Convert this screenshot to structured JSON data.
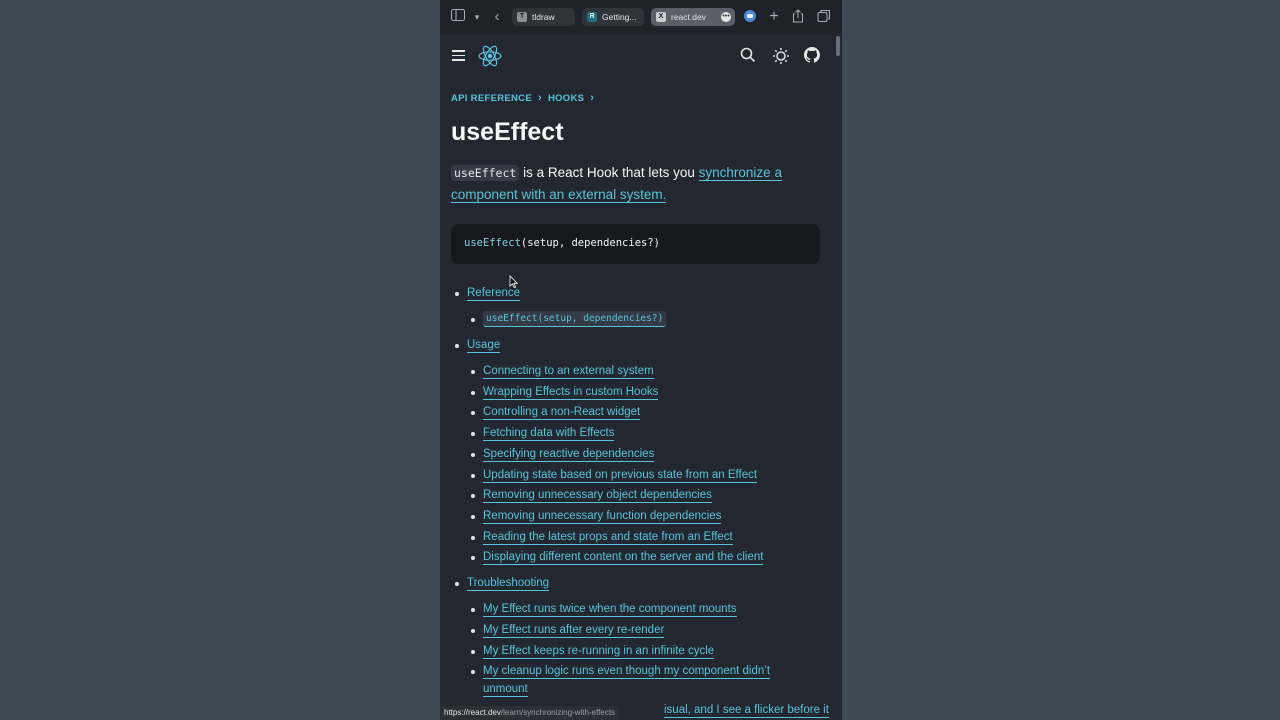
{
  "browser": {
    "tabs": [
      {
        "label": "tldraw",
        "favicon": "T"
      },
      {
        "label": "Getting...",
        "favicon": "R"
      },
      {
        "label": "react.dev",
        "favicon": "X"
      }
    ],
    "icons": [
      "sidebar-icon",
      "chevron-down-icon",
      "back-icon",
      "extension-icon",
      "new-tab-icon",
      "share-icon",
      "tabs-overview-icon"
    ]
  },
  "header": {
    "icons": [
      "menu-icon",
      "react-logo",
      "search-icon",
      "theme-toggle-icon",
      "github-icon"
    ]
  },
  "breadcrumb": {
    "items": [
      "API REFERENCE",
      "HOOKS"
    ]
  },
  "page": {
    "title": "useEffect",
    "intro_code": "useEffect",
    "intro_text": " is a React Hook that lets you ",
    "intro_link": "synchronize a component with an external system.",
    "signature_fn": "useEffect",
    "signature_args": "(setup, dependencies?)"
  },
  "toc": {
    "reference": "Reference",
    "reference_code": "useEffect(setup, dependencies?)",
    "usage": "Usage",
    "usage_items": [
      "Connecting to an external system",
      "Wrapping Effects in custom Hooks",
      "Controlling a non-React widget",
      "Fetching data with Effects",
      "Specifying reactive dependencies",
      "Updating state based on previous state from an Effect",
      "Removing unnecessary object dependencies",
      "Removing unnecessary function dependencies",
      "Reading the latest props and state from an Effect",
      "Displaying different content on the server and the client"
    ],
    "troubleshooting": "Troubleshooting",
    "troubleshooting_items": [
      "My Effect runs twice when the component mounts",
      "My Effect runs after every re-render",
      "My Effect keeps re-running in an infinite cycle",
      "My cleanup logic runs even though my component didn’t",
      "unmount",
      "isual, and I see a flicker before it"
    ]
  },
  "status": {
    "url_host": "https://react.dev",
    "url_path": "/learn/synchronizing-with-effects"
  },
  "colors": {
    "background": "#3f4954",
    "page_bg": "#23272f",
    "link": "#58c4dc",
    "text": "#f6f7f9"
  }
}
